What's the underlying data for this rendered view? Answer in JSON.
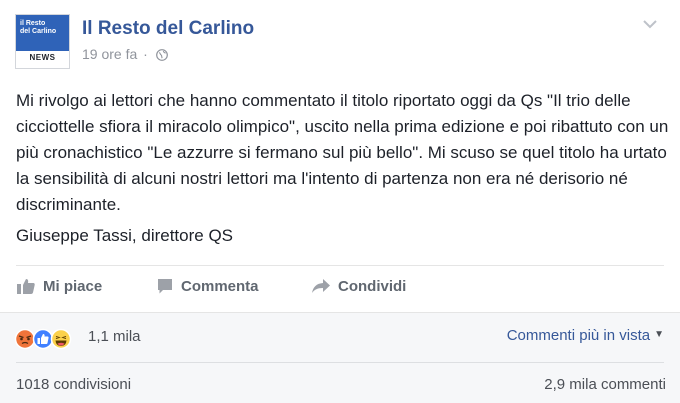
{
  "page": {
    "name": "Il Resto del Carlino",
    "logo_line1": "il Resto",
    "logo_line2": "del Carlino",
    "logo_badge": "NEWS"
  },
  "post": {
    "timestamp": "19 ore fa",
    "separator": "·",
    "text": "Mi rivolgo ai lettori che hanno commentato il titolo riportato oggi da Qs \"Il trio delle cicciottelle sfiora il miracolo olimpico\", uscito nella prima edizione e poi ribattuto con un più cronachistico \"Le azzurre si fermano sul più bello\". Mi scuso se quel titolo ha urtato la sensibilità di alcuni nostri lettori ma l'intento di partenza non era né derisorio né discriminante.",
    "signature": "Giuseppe Tassi, direttore QS"
  },
  "actions": {
    "like": "Mi piace",
    "comment": "Commenta",
    "share": "Condividi"
  },
  "reactions": {
    "icons": [
      "angry-icon",
      "like-icon",
      "haha-icon"
    ],
    "count": "1,1 mila",
    "sort_label": "Commenti più in vista"
  },
  "footer": {
    "shares": "1018 condivisioni",
    "comments": "2,9 mila commenti"
  },
  "colors": {
    "link": "#365899",
    "secondary": "#90949c",
    "text": "#1d2129",
    "band": "#f6f7f9"
  }
}
